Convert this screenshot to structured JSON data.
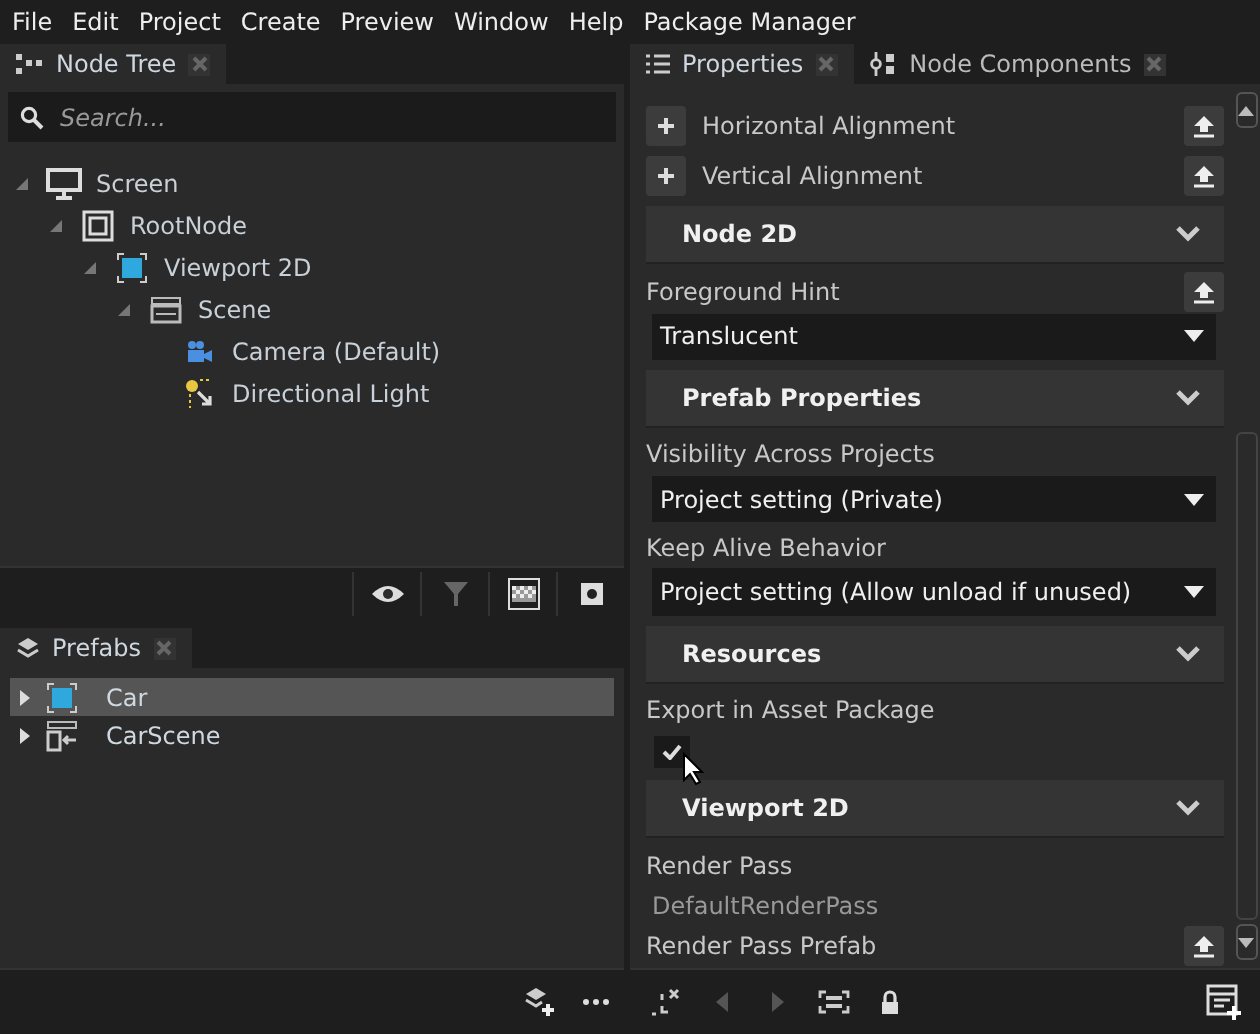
{
  "menu": [
    "File",
    "Edit",
    "Project",
    "Create",
    "Preview",
    "Window",
    "Help",
    "Package Manager"
  ],
  "node_tree": {
    "tab": {
      "title": "Node Tree",
      "selected": true
    },
    "search": {
      "placeholder": "Search..."
    },
    "tree": [
      {
        "label": "Screen",
        "kind": "screen",
        "expanded": true,
        "children": [
          {
            "label": "RootNode",
            "kind": "root",
            "expanded": true,
            "children": [
              {
                "label": "Viewport 2D",
                "kind": "viewport",
                "expanded": true,
                "children": [
                  {
                    "label": "Scene",
                    "kind": "scene",
                    "expanded": true,
                    "children": [
                      {
                        "label": "Camera (Default)",
                        "kind": "camera"
                      },
                      {
                        "label": "Directional Light",
                        "kind": "light"
                      }
                    ]
                  }
                ]
              }
            ]
          }
        ]
      }
    ]
  },
  "prefabs": {
    "tab": {
      "title": "Prefabs",
      "selected": true
    },
    "items": [
      {
        "label": "Car",
        "kind": "viewport",
        "selected": true,
        "expanded": false
      },
      {
        "label": "CarScene",
        "kind": "scene-prefab",
        "selected": false,
        "expanded": false
      }
    ]
  },
  "properties": {
    "tabs": [
      {
        "label": "Properties",
        "kind": "list",
        "selected": true
      },
      {
        "label": "Node Components",
        "kind": "components",
        "selected": false
      }
    ],
    "rows": [
      {
        "kind": "add-property",
        "label": "Horizontal Alignment"
      },
      {
        "kind": "add-property",
        "label": "Vertical Alignment"
      },
      {
        "kind": "section",
        "label": "Node 2D",
        "expanded": true
      },
      {
        "kind": "label-reset",
        "label": "Foreground Hint"
      },
      {
        "kind": "dropdown",
        "value": "Translucent"
      },
      {
        "kind": "section",
        "label": "Prefab Properties",
        "expanded": true
      },
      {
        "kind": "label",
        "label": "Visibility Across Projects"
      },
      {
        "kind": "dropdown",
        "value": "Project setting (Private)"
      },
      {
        "kind": "label",
        "label": "Keep Alive Behavior"
      },
      {
        "kind": "dropdown",
        "value": "Project setting (Allow unload if unused)"
      },
      {
        "kind": "section",
        "label": "Resources",
        "expanded": true
      },
      {
        "kind": "label",
        "label": "Export in Asset Package"
      },
      {
        "kind": "checkbox",
        "checked": true
      },
      {
        "kind": "section",
        "label": "Viewport 2D",
        "expanded": true
      },
      {
        "kind": "label",
        "label": "Render Pass"
      },
      {
        "kind": "value",
        "value": "DefaultRenderPass"
      },
      {
        "kind": "label-reset",
        "label": "Render Pass Prefab"
      }
    ]
  }
}
